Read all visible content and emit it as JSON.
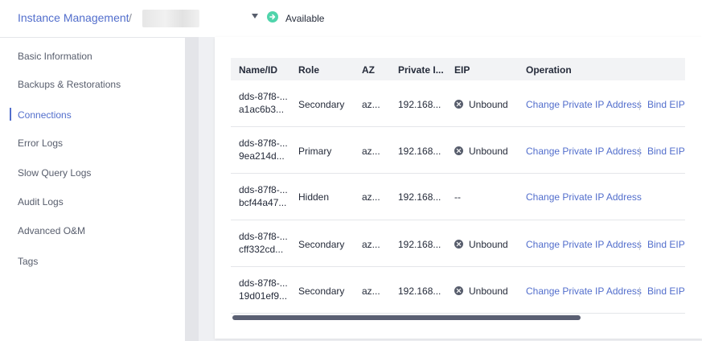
{
  "breadcrumb": {
    "root": "Instance Management",
    "separator": "/"
  },
  "status": {
    "label": "Available",
    "color": "#50d4ab"
  },
  "sidebar": {
    "items": [
      {
        "label": "Basic Information",
        "active": false
      },
      {
        "label": "Backups & Restorations",
        "active": false
      },
      {
        "label": "Connections",
        "active": true
      },
      {
        "label": "Error Logs",
        "active": false
      },
      {
        "label": "Slow Query Logs",
        "active": false
      },
      {
        "label": "Audit Logs",
        "active": false
      },
      {
        "label": "Advanced O&M",
        "active": false
      },
      {
        "label": "Tags",
        "active": false
      }
    ]
  },
  "table": {
    "columns": [
      "Name/ID",
      "Role",
      "AZ",
      "Private I...",
      "EIP",
      "Operation"
    ],
    "rows": [
      {
        "name_line1": "dds-87f8-...",
        "name_line2": "a1ac6b3...",
        "role": "Secondary",
        "az": "az...",
        "private_ip": "192.168...",
        "eip": "Unbound",
        "op_change": "Change Private IP Address",
        "op_bind": "Bind EIP"
      },
      {
        "name_line1": "dds-87f8-...",
        "name_line2": "9ea214d...",
        "role": "Primary",
        "az": "az...",
        "private_ip": "192.168...",
        "eip": "Unbound",
        "op_change": "Change Private IP Address",
        "op_bind": "Bind EIP"
      },
      {
        "name_line1": "dds-87f8-...",
        "name_line2": "bcf44a47...",
        "role": "Hidden",
        "az": "az...",
        "private_ip": "192.168...",
        "eip": "--",
        "op_change": "Change Private IP Address",
        "op_bind": ""
      },
      {
        "name_line1": "dds-87f8-...",
        "name_line2": "cff332cd...",
        "role": "Secondary",
        "az": "az...",
        "private_ip": "192.168...",
        "eip": "Unbound",
        "op_change": "Change Private IP Address",
        "op_bind": "Bind EIP"
      },
      {
        "name_line1": "dds-87f8-...",
        "name_line2": "19d01ef9...",
        "role": "Secondary",
        "az": "az...",
        "private_ip": "192.168...",
        "eip": "Unbound",
        "op_change": "Change Private IP Address",
        "op_bind": "Bind EIP"
      }
    ]
  },
  "colors": {
    "accent": "#526ecc",
    "status_available": "#50d4ab"
  }
}
